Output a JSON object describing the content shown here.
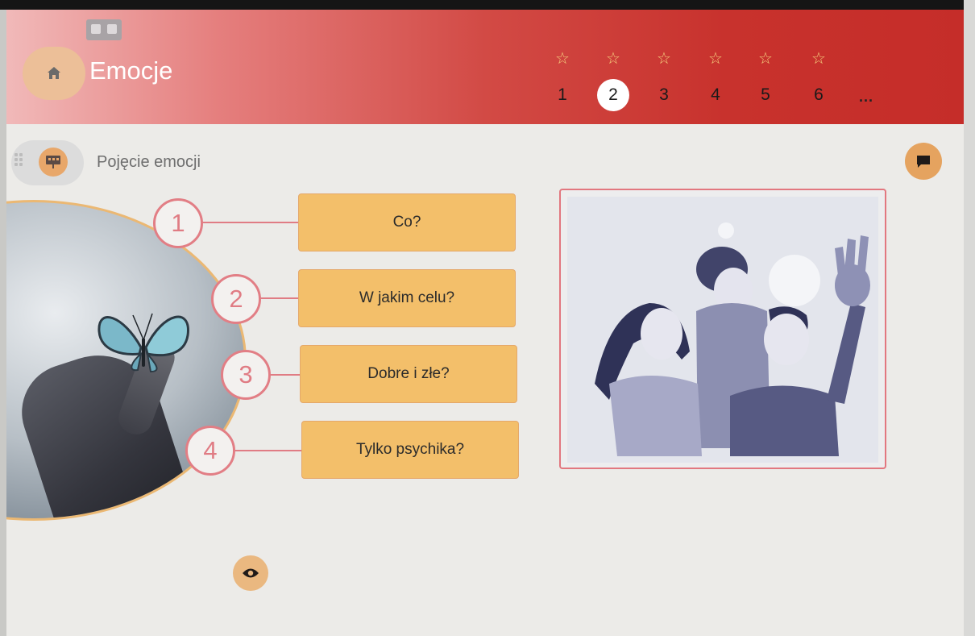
{
  "app": {
    "title": "Emocje"
  },
  "steps": [
    {
      "label": "1",
      "active": false
    },
    {
      "label": "2",
      "active": true
    },
    {
      "label": "3",
      "active": false
    },
    {
      "label": "4",
      "active": false
    },
    {
      "label": "5",
      "active": false
    },
    {
      "label": "6",
      "active": false
    }
  ],
  "steps_more": "...",
  "section": {
    "title": "Pojęcie emocji"
  },
  "options": [
    {
      "number": "1",
      "label": "Co?"
    },
    {
      "number": "2",
      "label": "W jakim celu?"
    },
    {
      "number": "3",
      "label": "Dobre i złe?"
    },
    {
      "number": "4",
      "label": "Tylko psychika?"
    }
  ],
  "icons": {
    "home": "home-icon",
    "cardboard": "vr-headset-icon",
    "section": "presentation-icon",
    "chat": "chat-icon",
    "eye": "eye-icon",
    "star": "star-outline-icon"
  },
  "colors": {
    "header_red": "#c8322d",
    "accent_orange": "#f3bf6a",
    "badge_pink": "#e07c84"
  }
}
